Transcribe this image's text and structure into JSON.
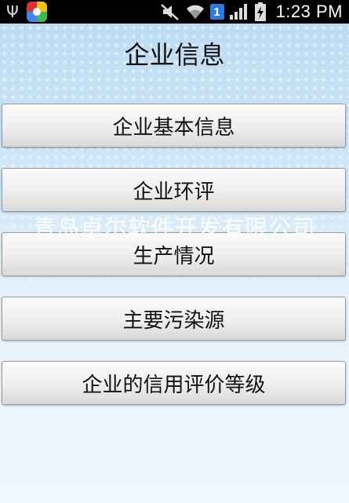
{
  "status_bar": {
    "left_icons": [
      "usb-icon",
      "app-icon"
    ],
    "right_icons": [
      "mute-icon",
      "wifi-icon",
      "sim-badge",
      "signal-icon",
      "battery-icon"
    ],
    "sim_number": "1",
    "time": "1:23 PM"
  },
  "page": {
    "title": "企业信息"
  },
  "menu": {
    "items": [
      {
        "label": "企业基本信息"
      },
      {
        "label": "企业环评"
      },
      {
        "label": "生产情况"
      },
      {
        "label": "主要污染源"
      },
      {
        "label": "企业的信用评价等级"
      }
    ]
  },
  "watermark": {
    "text": "青岛卓尔软件开发有限公司"
  },
  "colors": {
    "status_bar_bg": "#000000",
    "background_top": "#bcdcf3",
    "background_bottom": "#eef7fd",
    "button_face": "#eeeeee",
    "sim_badge": "#2a7be4"
  }
}
